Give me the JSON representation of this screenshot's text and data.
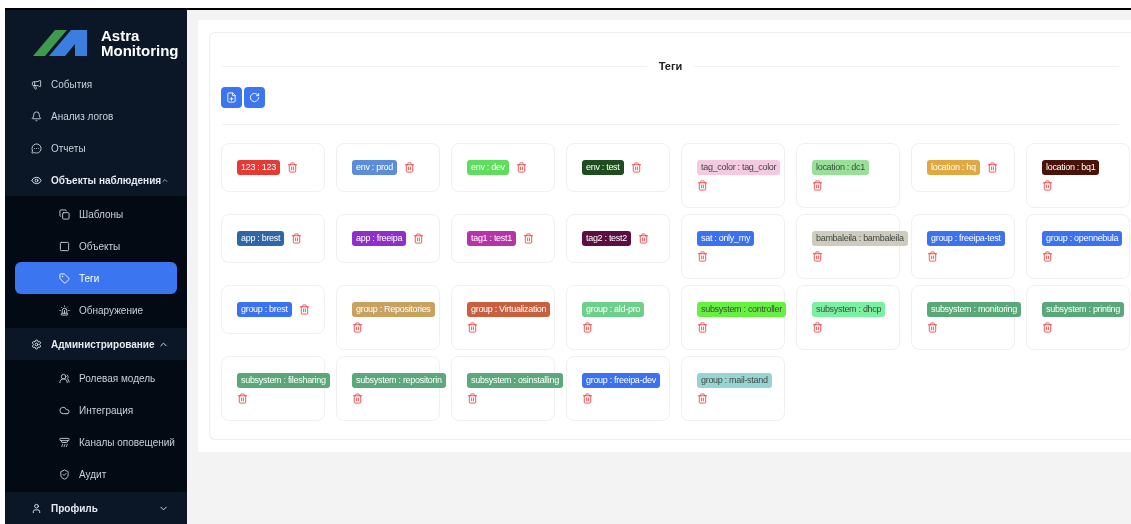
{
  "logo": {
    "line_1": "Astra",
    "line_2": "Monitoring"
  },
  "sidebar": {
    "items": [
      {
        "label": "События",
        "selected": false
      },
      {
        "label": "Анализ логов",
        "selected": false
      },
      {
        "label": "Отчеты",
        "selected": false
      },
      {
        "label": "Объекты наблюдения",
        "selected": false,
        "expanded": true,
        "children": [
          {
            "label": "Шаблоны",
            "selected": false
          },
          {
            "label": "Объекты",
            "selected": false
          },
          {
            "label": "Теги",
            "selected": true
          },
          {
            "label": "Обнаружение",
            "selected": false
          }
        ]
      },
      {
        "label": "Администрирование",
        "selected": false,
        "expanded": true,
        "children": [
          {
            "label": "Ролевая модель",
            "selected": false
          },
          {
            "label": "Интеграция",
            "selected": false
          },
          {
            "label": "Каналы оповещений",
            "selected": false
          },
          {
            "label": "Аудит",
            "selected": false
          }
        ]
      },
      {
        "label": "Профиль",
        "selected": false,
        "expanded": false
      }
    ]
  },
  "page": {
    "title": "Теги"
  },
  "tags": [
    {
      "label": "123 : 123",
      "color": "#e53935"
    },
    {
      "label": "env : prod",
      "color": "#5b8dd9"
    },
    {
      "label": "env : dev",
      "color": "#5fdd5f"
    },
    {
      "label": "env : test",
      "color": "#1f4d1f"
    },
    {
      "label": "tag_color : tag_color",
      "color": "#f5c9e0"
    },
    {
      "label": "location : dc1",
      "color": "#98e098"
    },
    {
      "label": "location : hq",
      "color": "#e0a840"
    },
    {
      "label": "location : bq1",
      "color": "#4a1208"
    },
    {
      "label": "app : brest",
      "color": "#2f66a8"
    },
    {
      "label": "app : freeipa",
      "color": "#8e30c8"
    },
    {
      "label": "tag1 : test1",
      "color": "#b832a8"
    },
    {
      "label": "tag2 : test2",
      "color": "#5a0f40"
    },
    {
      "label": "sat : only_my",
      "color": "#3a72f0"
    },
    {
      "label": "bambaleila : bambaleila",
      "color": "#cfcbbf"
    },
    {
      "label": "group : freeipa-test",
      "color": "#3a72f0"
    },
    {
      "label": "group : opennebula",
      "color": "#3a72f1"
    },
    {
      "label": "group : brest",
      "color": "#3a72f2"
    },
    {
      "label": "group : Repositories",
      "color": "#c8a060"
    },
    {
      "label": "group : Virtualization",
      "color": "#c86040"
    },
    {
      "label": "group : ald-pro",
      "color": "#6dd08a"
    },
    {
      "label": "subsystem : controller",
      "color": "#66f040"
    },
    {
      "label": "subsystem : dhcp",
      "color": "#7af0a0"
    },
    {
      "label": "subsystem : monitoring",
      "color": "#5aa878"
    },
    {
      "label": "subsystem : printing",
      "color": "#5aa879"
    },
    {
      "label": "subsystem : filesharing",
      "color": "#5aa87a"
    },
    {
      "label": "subsystem : repositorin",
      "color": "#5aa87b"
    },
    {
      "label": "subsystem : osinstalling",
      "color": "#5aa87c"
    },
    {
      "label": "group : freeipa-dev",
      "color": "#3a72f3"
    },
    {
      "label": "group : mail-stand",
      "color": "#99d4d4"
    }
  ]
}
